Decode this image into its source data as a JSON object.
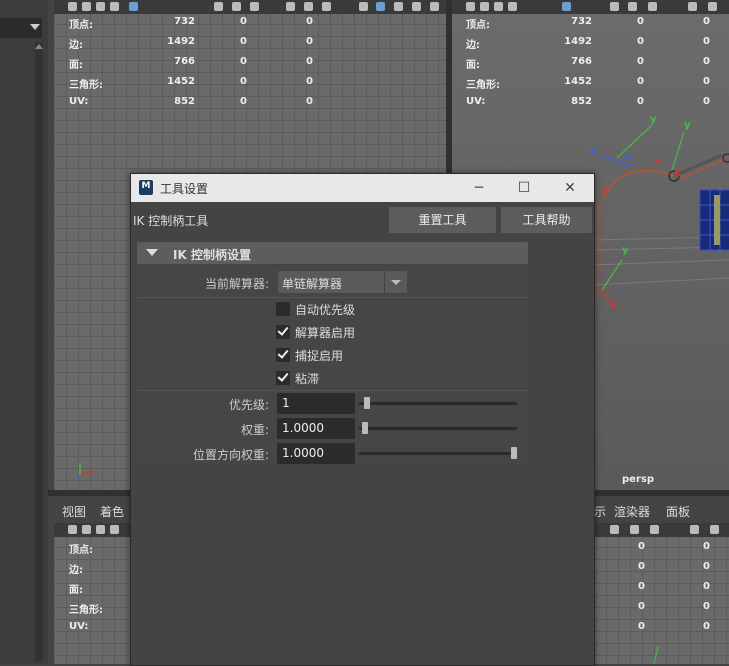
{
  "hud_labels": {
    "vertices": "顶点:",
    "edges": "边:",
    "faces": "面:",
    "tris": "三角形:",
    "uvs": "UV:"
  },
  "hud_values": {
    "vertices": [
      "732",
      "0",
      "0"
    ],
    "edges": [
      "1492",
      "0",
      "0"
    ],
    "faces": [
      "766",
      "0",
      "0"
    ],
    "tris": [
      "1452",
      "0",
      "0"
    ],
    "uvs": [
      "852",
      "0",
      "0"
    ]
  },
  "bottom_hud_values": {
    "vertices": [
      "0",
      "0"
    ],
    "edges": [
      "0",
      "0"
    ],
    "faces": [
      "0",
      "0"
    ],
    "tris": [
      "0",
      "0"
    ],
    "uvs": [
      "0",
      "0"
    ]
  },
  "viewport": {
    "camera_label": "persp",
    "axis_x": "x",
    "axis_y": "y",
    "axis_z": "z"
  },
  "bottom_menu_left": [
    "视图",
    "着色"
  ],
  "bottom_menu_right": [
    "示",
    "渲染器",
    "面板"
  ],
  "dialog": {
    "title": "工具设置",
    "logo": "M",
    "minimize": "─",
    "maximize": "☐",
    "close": "✕",
    "tool_name": "IK 控制柄工具",
    "reset_button": "重置工具",
    "help_button": "工具帮助",
    "section_title": "IK 控制柄设置",
    "solver_label": "当前解算器:",
    "solver_value": "单链解算器",
    "checkboxes": [
      {
        "label": "自动优先级",
        "checked": false
      },
      {
        "label": "解算器启用",
        "checked": true
      },
      {
        "label": "捕捉启用",
        "checked": true
      },
      {
        "label": "粘滞",
        "checked": true
      }
    ],
    "priority_label": "优先级:",
    "priority_value": "1",
    "weight_label": "权重:",
    "weight_value": "1.0000",
    "pos_weight_label": "位置方向权重:",
    "pos_weight_value": "1.0000",
    "sliders": {
      "priority_level": 0.03,
      "weight_level": 0.02,
      "pos_weight_level": 1.0
    }
  },
  "colors": {
    "accent_x": "#e03030",
    "accent_y": "#40c040",
    "accent_z": "#4060e0",
    "bone": "#c0502a"
  }
}
